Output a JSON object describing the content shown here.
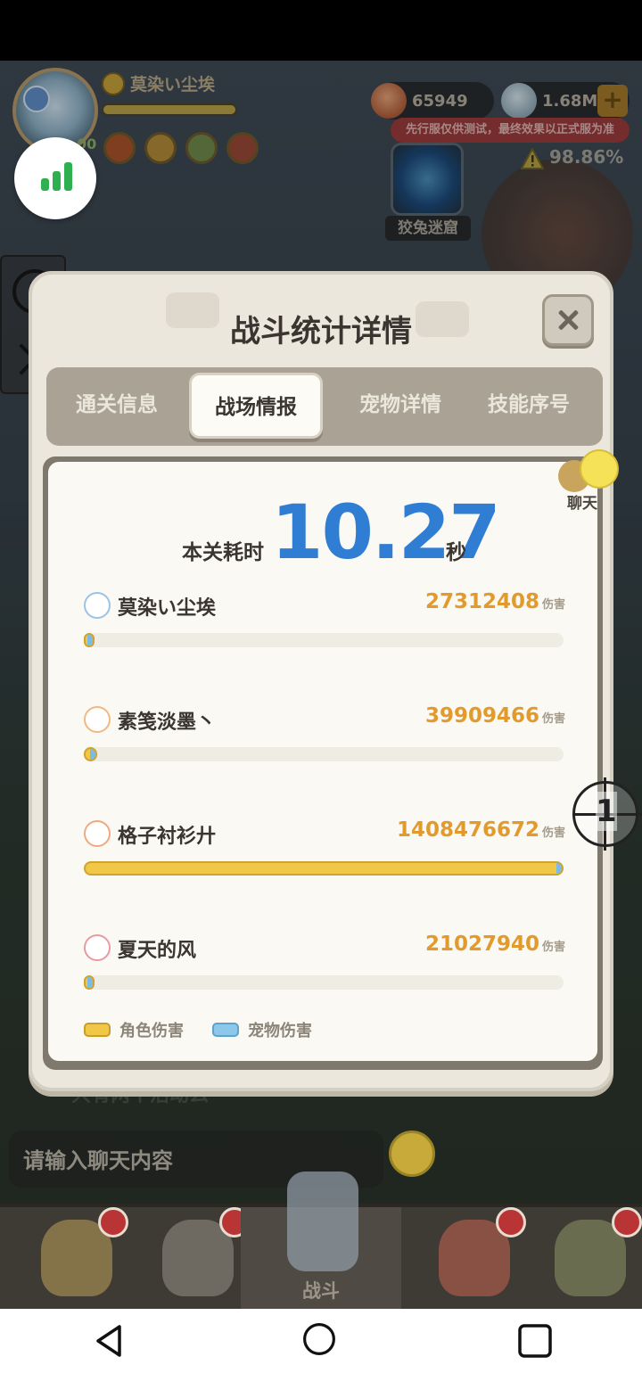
{
  "hud": {
    "player_name": "莫染い尘埃",
    "level": "00",
    "gold": "65949",
    "gems": "1.68M",
    "plus": "+",
    "test_notice": "先行服仅供测试，最终效果以正式服为准",
    "progress": "98.86%",
    "dungeon_label": "狡兔迷窟"
  },
  "modal": {
    "title": "战斗统计详情",
    "tabs": [
      {
        "label": "通关信息"
      },
      {
        "label": "战场情报"
      },
      {
        "label": "宠物详情"
      },
      {
        "label": "技能序号"
      }
    ],
    "active_tab": "战场情报",
    "time_label": "本关耗时",
    "time_value": "10.27",
    "time_unit": "秒",
    "players": [
      {
        "name": "莫染い尘埃",
        "damage": "27312408",
        "unit": "伤害",
        "fraction": 0.019,
        "icon": "class-blue-icon",
        "color": "#4a8fd6"
      },
      {
        "name": "素笺淡墨丶",
        "damage": "39909466",
        "unit": "伤害",
        "fraction": 0.028,
        "icon": "class-orange-icon",
        "color": "#e38a2c"
      },
      {
        "name": "格子衬衫廾",
        "damage": "1408476672",
        "unit": "伤害",
        "fraction": 1.0,
        "icon": "class-flame-icon",
        "color": "#e3702c"
      },
      {
        "name": "夏天的风",
        "damage": "21027940",
        "unit": "伤害",
        "fraction": 0.015,
        "icon": "class-red-icon",
        "color": "#d23a4a"
      }
    ],
    "legend": {
      "role": "角色伤害",
      "pet": "宠物伤害"
    }
  },
  "chat": {
    "bubble_label": "聊天",
    "input_placeholder": "请输入聊天内容",
    "partial_message": "只有两个活动么"
  },
  "side_marker": {
    "number": "1"
  },
  "bottom_nav": {
    "battle_label": "战斗"
  },
  "colors": {
    "time_blue": "#2f7ed4",
    "damage_orange": "#e39a2c",
    "role_yellow": "#f1c748",
    "pet_blue": "#7cbbe6"
  }
}
